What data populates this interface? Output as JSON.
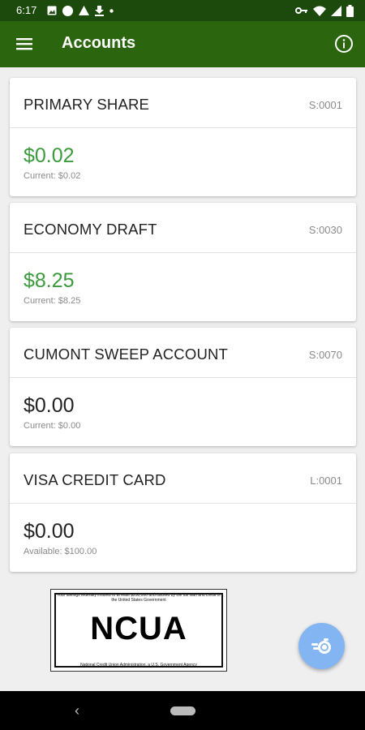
{
  "status_bar": {
    "time": "6:17"
  },
  "app_bar": {
    "title": "Accounts",
    "menu_icon": "menu-icon",
    "info_icon": "info-icon"
  },
  "accounts": [
    {
      "name": "PRIMARY SHARE",
      "number": "S:0001",
      "balance": "$0.02",
      "sub": "Current: $0.02",
      "highlight": true
    },
    {
      "name": "ECONOMY DRAFT",
      "number": "S:0030",
      "balance": "$8.25",
      "sub": "Current: $8.25",
      "highlight": true
    },
    {
      "name": "CUMONT SWEEP ACCOUNT",
      "number": "S:0070",
      "balance": "$0.00",
      "sub": "Current: $0.00",
      "highlight": false
    },
    {
      "name": "VISA CREDIT CARD",
      "number": "L:0001",
      "balance": "$0.00",
      "sub": "Available: $100.00",
      "highlight": false
    }
  ],
  "ncua": {
    "top_text": "Your savings federally insured to at least $250,000 and backed by the full faith and credit of the United States Government",
    "logo": "NCUA",
    "bottom_text": "National Credit Union Administration, a U.S. Government Agency"
  },
  "colors": {
    "status_bar": "#1b4a0c",
    "app_bar": "#2b660f",
    "positive_balance": "#3a9a3c",
    "fab": "#82b5f2"
  },
  "fab": {
    "icon": "transfer-coins-icon"
  }
}
